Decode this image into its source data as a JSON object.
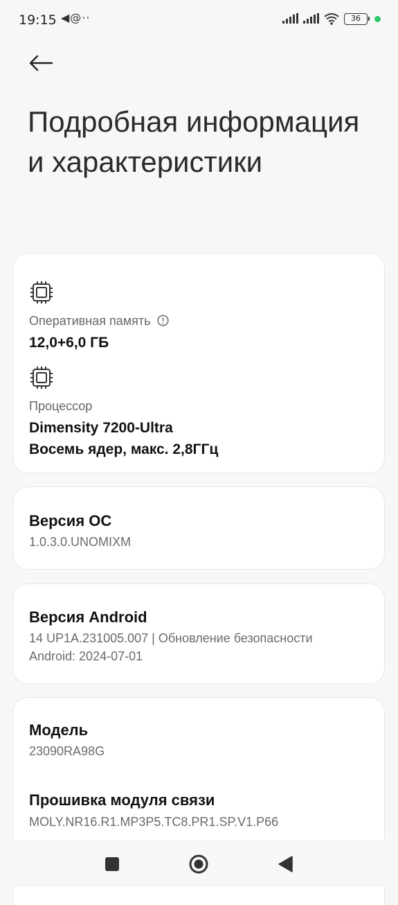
{
  "status_bar": {
    "time": "19:15",
    "notifications": "◀@··",
    "battery_level": "36"
  },
  "header": {
    "title": "Подробная информация и характеристики"
  },
  "specs": {
    "ram_label": "Оперативная память",
    "ram_value": "12,0+6,0 ГБ",
    "cpu_label": "Процессор",
    "cpu_value_line1": "Dimensity 7200-Ultra",
    "cpu_value_line2": "Восемь ядер, макс. 2,8ГГц"
  },
  "os": {
    "title": "Версия ОС",
    "value": "1.0.3.0.UNOMIXM"
  },
  "android": {
    "title": "Версия Android",
    "value_line1": "14 UP1A.231005.007 | Обновление безопасности",
    "value_line2": "Android: 2024-07-01"
  },
  "model": {
    "title": "Модель",
    "value": "23090RA98G"
  },
  "baseband": {
    "title": "Прошивка модуля связи",
    "value": "MOLY.NR16.R1.MP3P5.TC8.PR1.SP.V1.P66"
  },
  "colors": {
    "background": "#f7f7f7",
    "card": "#ffffff",
    "accent_green": "#2ec66a"
  },
  "icons": {
    "back": "arrow-left-icon",
    "chip": "chip-icon",
    "info": "info-icon",
    "nav_recents": "square-icon",
    "nav_home": "circle-icon",
    "nav_back": "triangle-back-icon"
  }
}
